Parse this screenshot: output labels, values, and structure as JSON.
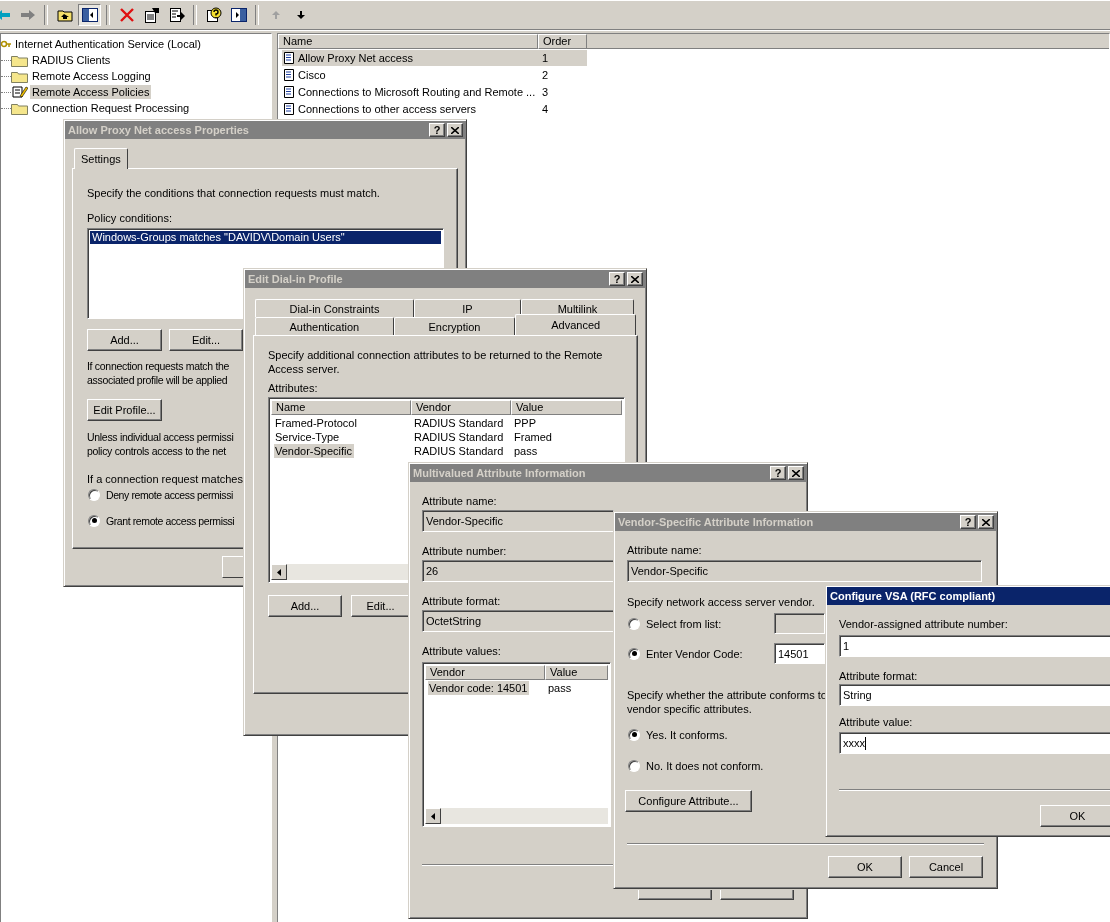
{
  "toolbar": [
    {
      "kind": "back",
      "disabled": false,
      "pressed": false
    },
    {
      "kind": "forward",
      "disabled": true,
      "pressed": false
    },
    {
      "kind": "up",
      "disabled": false,
      "pressed": false
    },
    {
      "kind": "tree",
      "disabled": false,
      "pressed": true
    },
    {
      "kind": "delete",
      "disabled": false,
      "pressed": false
    },
    {
      "kind": "properties",
      "disabled": false,
      "pressed": false
    },
    {
      "kind": "export",
      "disabled": false,
      "pressed": false
    },
    {
      "kind": "help",
      "disabled": false,
      "pressed": false
    },
    {
      "kind": "pane",
      "disabled": false,
      "pressed": false
    },
    {
      "kind": "move_up",
      "disabled": true,
      "pressed": false
    },
    {
      "kind": "move_down",
      "disabled": false,
      "pressed": false
    }
  ],
  "tree": {
    "label": "Internet Authentication Service (Local)",
    "kind": "service",
    "selected": false,
    "children": [
      {
        "label": "RADIUS Clients",
        "kind": "folder",
        "selected": false
      },
      {
        "label": "Remote Access Logging",
        "kind": "folder",
        "selected": false
      },
      {
        "label": "Remote Access Policies",
        "kind": "policy",
        "selected": true
      },
      {
        "label": "Connection Request Processing",
        "kind": "folder",
        "selected": false
      }
    ]
  },
  "policy_list": {
    "columns": [
      "Name",
      "Order"
    ],
    "rows": [
      {
        "name": "Allow Proxy Net access",
        "order": "1",
        "selected": true
      },
      {
        "name": "Cisco",
        "order": "2",
        "selected": false
      },
      {
        "name": "Connections to Microsoft Routing and Remote ...",
        "order": "3",
        "selected": false
      },
      {
        "name": "Connections to other access servers",
        "order": "4",
        "selected": false
      }
    ]
  },
  "properties_dialog": {
    "title": "Allow Proxy Net access Properties",
    "active": false,
    "help_button": "?",
    "tabs": [
      {
        "label": "Settings",
        "selected": true
      }
    ],
    "intro": "Specify the conditions that connection requests must match.",
    "conditions_label": "Policy conditions:",
    "conditions": [
      {
        "text": "Windows-Groups matches \"DAVIDV\\Domain Users\"",
        "selected": true
      }
    ],
    "buttons": [
      "Add...",
      "Edit..."
    ],
    "profile_text": [
      "If connection requests match the",
      "associated profile will be applied"
    ],
    "edit_profile_button": "Edit Profile...",
    "permission_text": [
      "Unless individual access permissi",
      "policy controls access to the net"
    ],
    "match_text": "If a connection request matches",
    "radios": [
      {
        "label": "Deny remote access permissi",
        "selected": false
      },
      {
        "label": "Grant remote access permissi",
        "selected": true
      }
    ]
  },
  "profile_dialog": {
    "title": "Edit Dial-in Profile",
    "active": false,
    "help_button": "?",
    "tab_rows": [
      [
        {
          "label": "Dial-in Constraints",
          "selected": false
        },
        {
          "label": "IP",
          "selected": false
        },
        {
          "label": "Multilink",
          "selected": false
        }
      ],
      [
        {
          "label": "Authentication",
          "selected": false
        },
        {
          "label": "Encryption",
          "selected": false
        },
        {
          "label": "Advanced",
          "selected": true
        }
      ]
    ],
    "intro": "Specify additional connection attributes to be returned to the Remote Access server.",
    "attributes_label": "Attributes:",
    "columns": [
      "Name",
      "Vendor",
      "Value"
    ],
    "rows": [
      {
        "name": "Framed-Protocol",
        "vendor": "RADIUS Standard",
        "value": "PPP",
        "selected": false
      },
      {
        "name": "Service-Type",
        "vendor": "RADIUS Standard",
        "value": "Framed",
        "selected": false
      },
      {
        "name": "Vendor-Specific",
        "vendor": "RADIUS Standard",
        "value": "pass",
        "selected": true
      }
    ],
    "buttons": [
      "Add...",
      "Edit..."
    ]
  },
  "multivalued_dialog": {
    "title": "Multivalued Attribute Information",
    "active": false,
    "help_button": "?",
    "fields": [
      {
        "label": "Attribute name:",
        "value": "Vendor-Specific"
      },
      {
        "label": "Attribute number:",
        "value": "26"
      },
      {
        "label": "Attribute format:",
        "value": "OctetString"
      }
    ],
    "values_label": "Attribute values:",
    "columns": [
      "Vendor",
      "Value"
    ],
    "rows": [
      {
        "vendor": "Vendor code: 14501",
        "value": "pass",
        "selected": true
      }
    ]
  },
  "vsa_info_dialog": {
    "title": "Vendor-Specific Attribute Information",
    "active": false,
    "help_button": "?",
    "name_label": "Attribute name:",
    "name_value": "Vendor-Specific",
    "vendor_prompt": "Specify network access server vendor.",
    "vendor_options": [
      {
        "label": "Select from list:",
        "selected": false
      },
      {
        "label": "Enter Vendor Code:",
        "selected": true
      }
    ],
    "vendor_code": "14501",
    "conform_prompt": [
      "Specify whether the attribute conforms to",
      "vendor specific attributes."
    ],
    "conform_options": [
      {
        "label": "Yes. It conforms.",
        "selected": true
      },
      {
        "label": "No. It does not conform.",
        "selected": false
      }
    ],
    "configure_button": "Configure Attribute...",
    "buttons": [
      "OK",
      "Cancel"
    ]
  },
  "configure_vsa_dialog": {
    "title": "Configure VSA (RFC compliant)",
    "active": true,
    "fields": [
      {
        "label": "Vendor-assigned attribute number:",
        "value": "1",
        "focused": false
      },
      {
        "label": "Attribute format:",
        "value": "String",
        "focused": false
      },
      {
        "label": "Attribute value:",
        "value": "xxxx",
        "focused": true
      }
    ],
    "ok_button": "OK"
  }
}
